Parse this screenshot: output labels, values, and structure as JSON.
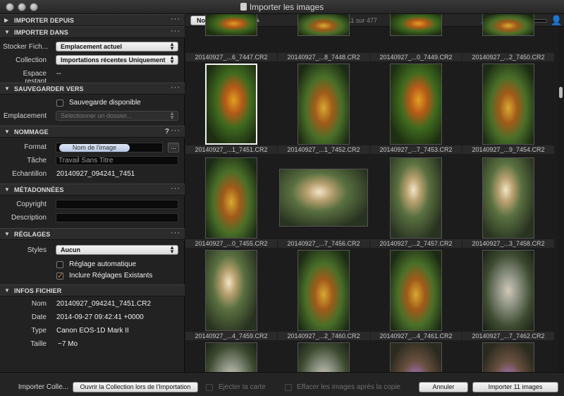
{
  "window": {
    "title": "Importer les images"
  },
  "sections": {
    "import_from": "IMPORTER DEPUIS",
    "import_into": "IMPORTER DANS",
    "backup": "SAUVEGARDER VERS",
    "naming": "NOMMAGE",
    "metadata": "MÉTADONNÉES",
    "settings": "RÉGLAGES",
    "file_info": "INFOS FICHIER"
  },
  "import_into": {
    "store_label": "Stocker Fich...",
    "store_value": "Emplacement actuel",
    "collection_label": "Collection",
    "collection_value": "Importations récentes Uniquement",
    "space_label": "Espace restant",
    "space_value": "--"
  },
  "backup": {
    "checkbox_label": "Sauvegarde disponible",
    "location_label": "Emplacement",
    "location_placeholder": "Selectionner un dossier..."
  },
  "naming": {
    "help": "?",
    "format_label": "Format",
    "format_token": "Nom de l'image",
    "format_button": "...",
    "task_label": "Tâche",
    "task_value": "Travail Sans Titre",
    "sample_label": "Echantillon",
    "sample_value": "20140927_094241_7451"
  },
  "metadata": {
    "copyright_label": "Copyright",
    "copyright_value": "",
    "description_label": "Description",
    "description_value": ""
  },
  "settings": {
    "styles_label": "Styles",
    "styles_value": "Aucun",
    "auto_label": "Réglage automatique",
    "auto_checked": false,
    "existing_label": "Inclure Réglages Existants",
    "existing_checked": true
  },
  "file_info": {
    "name_label": "Nom",
    "name_value": "20140927_094241_7451.CR2",
    "date_label": "Date",
    "date_value": "2014-09-27 09:42:41 +0000",
    "type_label": "Type",
    "type_value": "Canon EOS-1D Mark II",
    "size_label": "Taille",
    "size_value": "~7 Mo"
  },
  "toolbar": {
    "sort_value": "Nom",
    "count_text": "11 sur 477",
    "thumbnail_size": 0.25
  },
  "thumbnails": [
    {
      "name": "20140927_...6_7447.CR2",
      "style": "imgA"
    },
    {
      "name": "20140927_...8_7448.CR2",
      "style": "imgB"
    },
    {
      "name": "20140927_...0_7449.CR2",
      "style": "imgA"
    },
    {
      "name": "20140927_...2_7450.CR2",
      "style": "imgB"
    },
    {
      "name": "20140927_...1_7451.CR2",
      "style": "imgA"
    },
    {
      "name": "20140927_...1_7452.CR2",
      "style": "imgB"
    },
    {
      "name": "20140927_...7_7453.CR2",
      "style": "imgA"
    },
    {
      "name": "20140927_...9_7454.CR2",
      "style": "imgB"
    },
    {
      "name": "20140927_...0_7455.CR2",
      "style": "imgB"
    },
    {
      "name": "20140927_...7_7456.CR2",
      "style": "imgC"
    },
    {
      "name": "20140927_...2_7457.CR2",
      "style": "imgC"
    },
    {
      "name": "20140927_...3_7458.CR2",
      "style": "imgC"
    },
    {
      "name": "20140927_...4_7459.CR2",
      "style": "imgC"
    },
    {
      "name": "20140927_...2_7460.CR2",
      "style": "imgB"
    },
    {
      "name": "20140927_...4_7461.CR2",
      "style": "imgB"
    },
    {
      "name": "20140927_...7_7462.CR2",
      "style": "imgD"
    },
    {
      "name": "",
      "style": "imgD"
    },
    {
      "name": "",
      "style": "imgD"
    },
    {
      "name": "",
      "style": "imgE"
    },
    {
      "name": "",
      "style": "imgE"
    }
  ],
  "bottom": {
    "import_collection_label": "Importer Colle...",
    "open_collection_button": "Ouvrir la Collection lors de l'Importation",
    "eject_label": "Ejecter la carte",
    "erase_label": "Effacer les images après la copie",
    "cancel_button": "Annuler",
    "import_button": "Importer 11 images"
  }
}
